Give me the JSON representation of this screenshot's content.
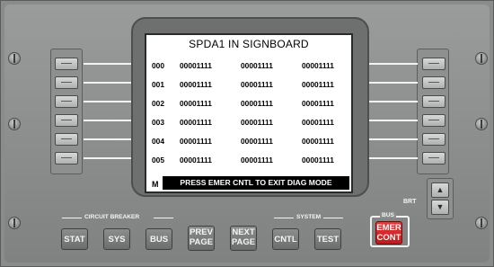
{
  "screen": {
    "title": "SPDA1 IN SIGNBOARD",
    "rows": [
      [
        "000",
        "00001111",
        "00001111",
        "00001111"
      ],
      [
        "001",
        "00001111",
        "00001111",
        "00001111"
      ],
      [
        "002",
        "00001111",
        "00001111",
        "00001111"
      ],
      [
        "003",
        "00001111",
        "00001111",
        "00001111"
      ],
      [
        "004",
        "00001111",
        "00001111",
        "00001111"
      ],
      [
        "005",
        "00001111",
        "00001111",
        "00001111"
      ]
    ],
    "mode_indicator": "M",
    "message": "PRESS EMER CNTL TO EXIT DIAG MODE"
  },
  "legends": {
    "circuit_breaker": "CIRCUIT BREAKER",
    "system": "SYSTEM",
    "bus": "BUS",
    "brt": "BRT"
  },
  "buttons": {
    "stat": "STAT",
    "sys": "SYS",
    "bus": "BUS",
    "prev_page": [
      "PREV",
      "PAGE"
    ],
    "next_page": [
      "NEXT",
      "PAGE"
    ],
    "cntl": "CNTL",
    "test": "TEST",
    "emer_cont": [
      "EMER",
      "CONT"
    ]
  },
  "icons": {
    "brt_up": "▲",
    "brt_down": "▼"
  },
  "colors": {
    "panel": "#8a8c8c",
    "screen_bg": "#ffffff",
    "message_bg": "#000000",
    "emer_button": "#d42a2c"
  }
}
